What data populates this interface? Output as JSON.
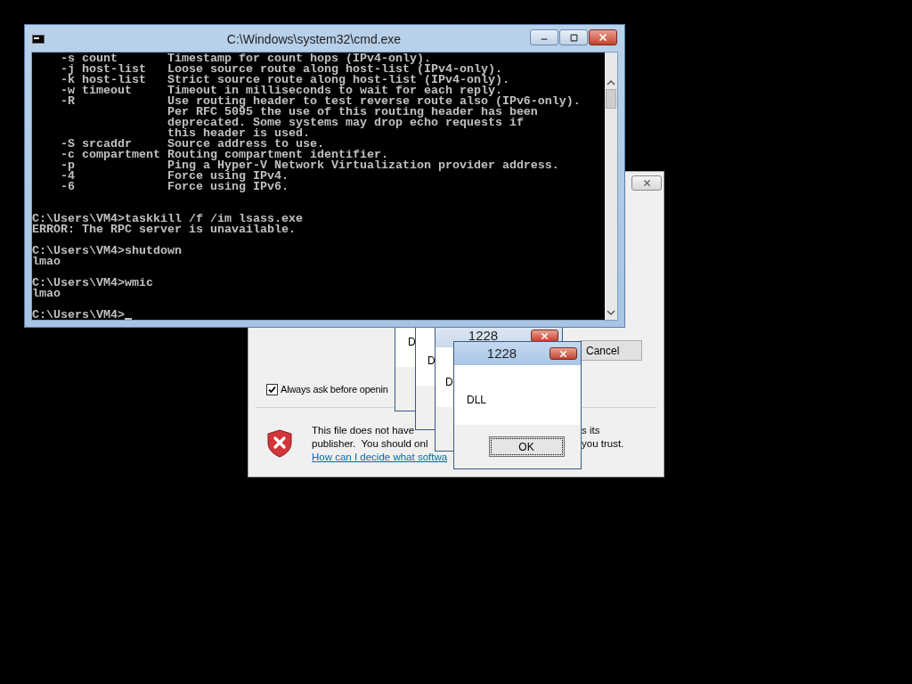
{
  "cmd_window": {
    "title": "C:\\Windows\\system32\\cmd.exe",
    "lines": [
      {
        "kind": "text",
        "text": "    -s count       Timestamp for count hops (IPv4-only)."
      },
      {
        "kind": "text",
        "text": "    -j host-list   Loose source route along host-list (IPv4-only)."
      },
      {
        "kind": "text",
        "text": "    -k host-list   Strict source route along host-list (IPv4-only)."
      },
      {
        "kind": "text",
        "text": "    -w timeout     Timeout in milliseconds to wait for each reply."
      },
      {
        "kind": "text",
        "text": "    -R             Use routing header to test reverse route also (IPv6-only)."
      },
      {
        "kind": "text",
        "text": "                   Per RFC 5095 the use of this routing header has been"
      },
      {
        "kind": "text",
        "text": "                   deprecated. Some systems may drop echo requests if"
      },
      {
        "kind": "text",
        "text": "                   this header is used."
      },
      {
        "kind": "text",
        "text": "    -S srcaddr     Source address to use."
      },
      {
        "kind": "text",
        "text": "    -c compartment Routing compartment identifier."
      },
      {
        "kind": "text",
        "text": "    -p             Ping a Hyper-V Network Virtualization provider address."
      },
      {
        "kind": "text",
        "text": "    -4             Force using IPv4."
      },
      {
        "kind": "text",
        "text": "    -6             Force using IPv6."
      },
      {
        "kind": "blank"
      },
      {
        "kind": "blank"
      },
      {
        "kind": "text",
        "text": "C:\\Users\\VM4>taskkill /f /im lsass.exe"
      },
      {
        "kind": "text",
        "text": "ERROR: The RPC server is unavailable."
      },
      {
        "kind": "blank"
      },
      {
        "kind": "text",
        "text": "C:\\Users\\VM4>shutdown"
      },
      {
        "kind": "text",
        "text": "lmao"
      },
      {
        "kind": "blank"
      },
      {
        "kind": "text",
        "text": "C:\\Users\\VM4>wmic"
      },
      {
        "kind": "text",
        "text": "lmao"
      },
      {
        "kind": "blank"
      },
      {
        "kind": "prompt",
        "text": "C:\\Users\\VM4>",
        "cursor": true
      }
    ]
  },
  "security_warning": {
    "cancel_button": "Cancel",
    "checkbox": {
      "label": "Always ask before openin",
      "checked": true
    },
    "warning_rows": [
      {
        "left": "This file does not have",
        "right": "s its"
      },
      {
        "left": "publisher.  You should onl",
        "right": "you trust."
      }
    ],
    "link": "How can I decide what softwa"
  },
  "message_boxes": [
    {
      "text": "D"
    },
    {
      "text": "D"
    },
    {
      "title": "1228",
      "text": "D",
      "active": false
    },
    {
      "title": "1228",
      "text": "DLL",
      "button": "OK",
      "active": true
    }
  ]
}
